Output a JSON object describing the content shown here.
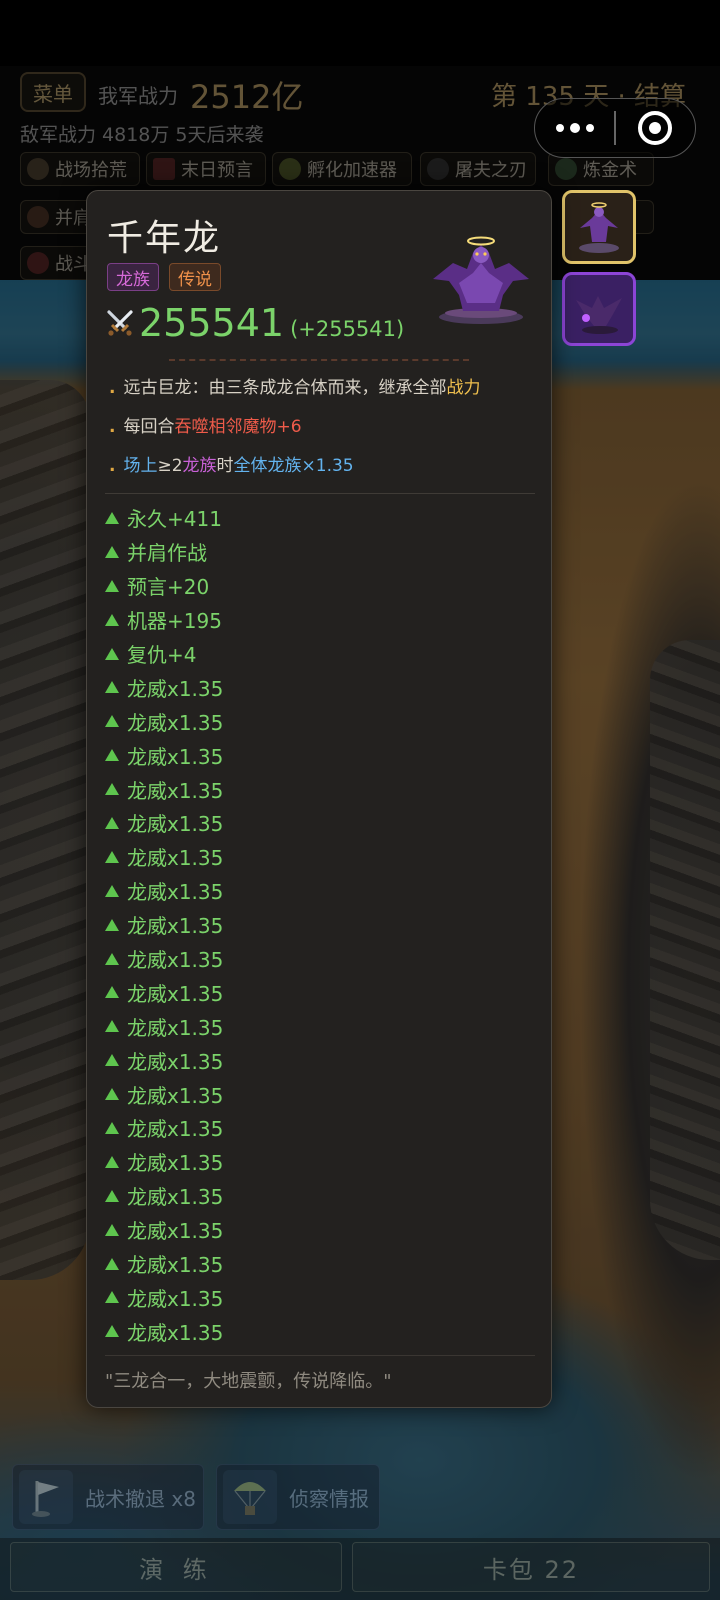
{
  "header": {
    "menu_label": "菜单",
    "power_label": "我军战力",
    "power_value": "2512亿",
    "day_label": "第 135 天 · 结算",
    "enemy_line": "敌军战力 4818万  5天后来袭",
    "chips": [
      {
        "label": "战场拾荒",
        "icon": "scavenge-icon"
      },
      {
        "label": "末日预言",
        "icon": "prophecy-book-icon"
      },
      {
        "label": "孵化加速器",
        "icon": "incubator-icon"
      },
      {
        "label": "屠夫之刃",
        "icon": "blade-icon"
      },
      {
        "label": "炼金术",
        "icon": "alchemy-icon"
      },
      {
        "label": "并肩",
        "icon": "helmet-icon"
      },
      {
        "label": "战斗",
        "icon": "battle-icon"
      }
    ]
  },
  "card": {
    "title": "千年龙",
    "tag_race": "龙族",
    "tag_rarity": "传说",
    "power": "255541",
    "power_delta": "(+255541)",
    "desc1_a": "远古巨龙：由三条成龙合体而来，继承全部",
    "desc1_b": "战力",
    "desc2_a": "每回合",
    "desc2_b": "吞噬相邻魔物+6",
    "desc3_a": "场上",
    "desc3_b": "≥2",
    "desc3_c": "龙族",
    "desc3_d": "时",
    "desc3_e": "全体龙族×1.35",
    "buffs": [
      "永久+411",
      "并肩作战",
      "预言+20",
      "机器+195",
      "复仇+4",
      "龙威x1.35",
      "龙威x1.35",
      "龙威x1.35",
      "龙威x1.35",
      "龙威x1.35",
      "龙威x1.35",
      "龙威x1.35",
      "龙威x1.35",
      "龙威x1.35",
      "龙威x1.35",
      "龙威x1.35",
      "龙威x1.35",
      "龙威x1.35",
      "龙威x1.35",
      "龙威x1.35",
      "龙威x1.35",
      "龙威x1.35",
      "龙威x1.35",
      "龙威x1.35",
      "龙威x1.35"
    ],
    "flavor": "\"三龙合一，大地震颤，传说降临。\""
  },
  "skills": {
    "retreat": "战术撤退 x8",
    "scout": "侦察情报"
  },
  "bottom": {
    "drill": "演 练",
    "pack": "卡包 22"
  },
  "colors": {
    "accent_gold": "#e5c27c",
    "buff_green": "#7bd36a",
    "race_purple": "#c861d6",
    "rarity_orange": "#f0914a"
  }
}
